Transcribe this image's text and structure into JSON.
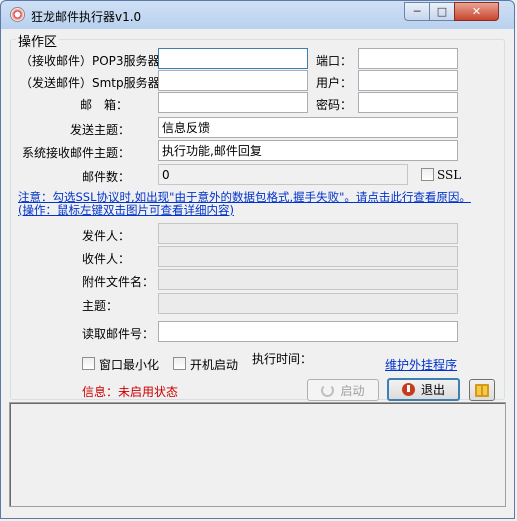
{
  "window": {
    "title": "狂龙邮件执行器v1.0",
    "icon": "app-logo-icon",
    "buttons": {
      "minimize": "minimize-icon",
      "maximize": "maximize-icon",
      "close": "close-icon"
    }
  },
  "group": {
    "title": "操作区"
  },
  "form": {
    "pop3_label": "（接收邮件）POP3服务器：",
    "pop3_value": "",
    "port_label": "端口：",
    "port_value": "",
    "smtp_label": "（发送邮件）Smtp服务器：",
    "smtp_value": "",
    "user_label": "用户：",
    "user_value": "",
    "mailbox_label": "邮　箱：",
    "mailbox_value": "",
    "password_label": "密码：",
    "password_value": "",
    "send_subject_label": "发送主题：",
    "send_subject_value": "信息反馈",
    "recv_subject_label": "系统接收邮件主题：",
    "recv_subject_value": "执行功能,邮件回复",
    "mail_count_label": "邮件数：",
    "mail_count_value": "0",
    "ssl_label": "SSL"
  },
  "notice": {
    "line1": "注意：勾选SSL协议时,如出现\"由于意外的数据包格式,握手失败\"。请点击此行查看原因。",
    "line2": "(操作：鼠标左键双击图片可查看详细内容)"
  },
  "details": {
    "sender_label": "发件人：",
    "sender_value": "",
    "recipient_label": "收件人：",
    "recipient_value": "",
    "attachment_label": "附件文件名：",
    "attachment_value": "",
    "subject_label": "主题：",
    "subject_value": "",
    "read_no_label": "读取邮件号：",
    "read_no_value": ""
  },
  "options": {
    "minimize_label": "窗口最小化",
    "autostart_label": "开机启动",
    "exec_time_label": "执行时间：",
    "plugin_link": "维护外挂程序"
  },
  "status": {
    "info": "信息：未启用状态"
  },
  "actions": {
    "start_label": "启动",
    "exit_label": "退出"
  },
  "icons": {
    "start": "refresh-icon",
    "exit": "power-icon",
    "help": "book-icon"
  }
}
